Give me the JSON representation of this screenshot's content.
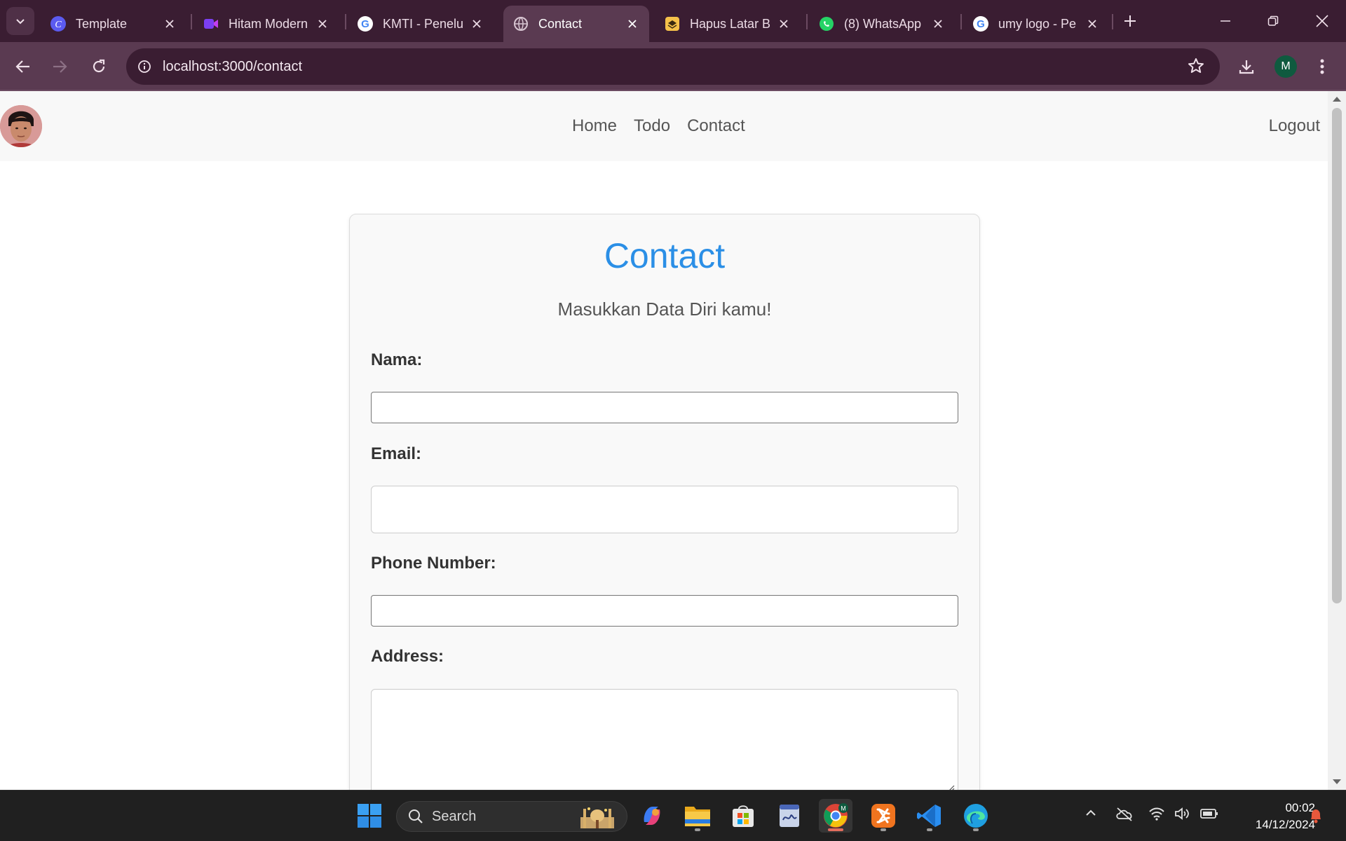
{
  "browser": {
    "tabs": [
      {
        "title": "Template",
        "active": false
      },
      {
        "title": "Hitam Modern",
        "active": false
      },
      {
        "title": "KMTI - Penelu",
        "active": false
      },
      {
        "title": "Contact",
        "active": true
      },
      {
        "title": "Hapus Latar B",
        "active": false
      },
      {
        "title": "(8) WhatsApp",
        "active": false
      },
      {
        "title": "umy logo - Pe",
        "active": false
      }
    ],
    "url": "localhost:3000/contact",
    "profile_initial": "M",
    "colors": {
      "frame": "#3a1d32",
      "toolbar": "#5a3a51"
    }
  },
  "site": {
    "nav_links": [
      "Home",
      "Todo",
      "Contact"
    ],
    "logout": "Logout"
  },
  "form": {
    "title": "Contact",
    "subtitle": "Masukkan Data Diri kamu!",
    "fields": [
      {
        "label": "Nama:",
        "value": ""
      },
      {
        "label": "Email:",
        "value": ""
      },
      {
        "label": "Phone Number:",
        "value": ""
      },
      {
        "label": "Address:",
        "value": ""
      }
    ],
    "title_color": "#2b8fe6"
  },
  "taskbar": {
    "search_label": "Search",
    "time": "00:02",
    "date": "14/12/2024"
  }
}
